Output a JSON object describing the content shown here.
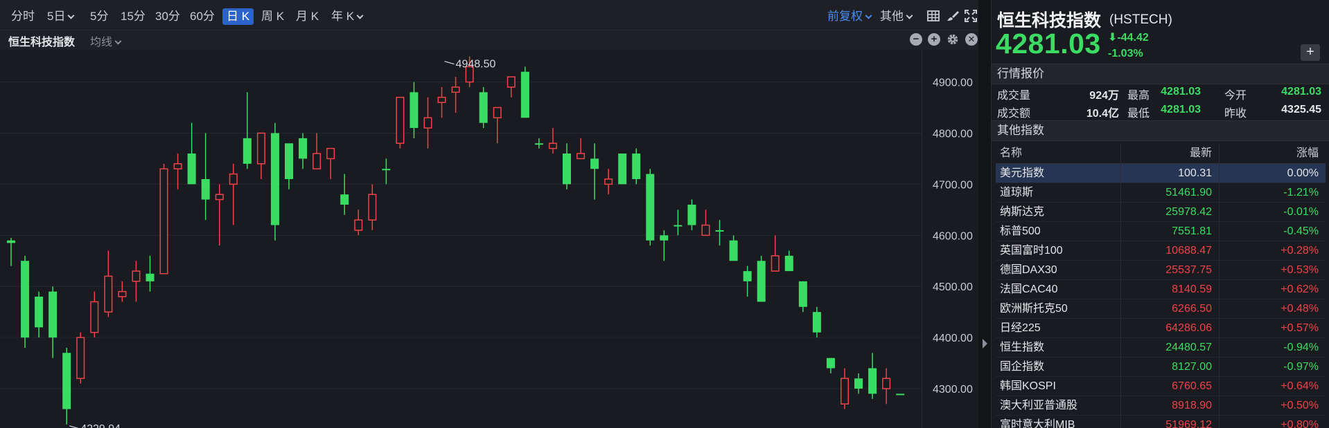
{
  "toolbar": {
    "periods": [
      {
        "label": "分时",
        "caret": false,
        "active": false
      },
      {
        "label": "5日",
        "caret": true,
        "active": false
      },
      {
        "label": "5分",
        "caret": false,
        "active": false
      },
      {
        "label": "15分",
        "caret": false,
        "active": false
      },
      {
        "label": "30分",
        "caret": false,
        "active": false
      },
      {
        "label": "60分",
        "caret": false,
        "active": false
      },
      {
        "label": "日 K",
        "caret": false,
        "active": true
      },
      {
        "label": "周 K",
        "caret": false,
        "active": false
      },
      {
        "label": "月 K",
        "caret": false,
        "active": false
      },
      {
        "label": "年 K",
        "caret": true,
        "active": false
      }
    ],
    "adjust_label": "前复权",
    "other_label": "其他",
    "icons": [
      "grid-icon",
      "brush-icon",
      "fullscreen-icon"
    ]
  },
  "chart": {
    "title": "恒生科技指数",
    "ma_label": "均线",
    "controls": [
      "minus-icon",
      "plus-icon",
      "gear-icon",
      "close-icon"
    ]
  },
  "chart_data": {
    "type": "candlestick",
    "y_ticks": [
      4900,
      4800,
      4700,
      4600,
      4500,
      4400,
      4300
    ],
    "y_tick_labels": [
      "4900.00",
      "4800.00",
      "4700.00",
      "4600.00",
      "4500.00",
      "4400.00",
      "4300.00"
    ],
    "ylim": [
      4223,
      4963
    ],
    "max_annotation": {
      "label": "4948.50",
      "index": 31,
      "value": 4948.5
    },
    "min_annotation": {
      "label": "4229.94",
      "index": 4,
      "value": 4229.94
    },
    "colors": {
      "up": "#f0424a",
      "down": "#3bdc64"
    },
    "candles": [
      [
        4590,
        4585,
        4595,
        4540
      ],
      [
        4550,
        4400,
        4560,
        4380
      ],
      [
        4480,
        4420,
        4490,
        4400
      ],
      [
        4490,
        4400,
        4500,
        4360
      ],
      [
        4370,
        4260,
        4380,
        4230
      ],
      [
        4320,
        4400,
        4410,
        4310
      ],
      [
        4410,
        4470,
        4490,
        4400
      ],
      [
        4450,
        4520,
        4570,
        4440
      ],
      [
        4480,
        4490,
        4510,
        4470
      ],
      [
        4510,
        4530,
        4550,
        4470
      ],
      [
        4525,
        4510,
        4560,
        4490
      ],
      [
        4525,
        4730,
        4740,
        4525
      ],
      [
        4730,
        4740,
        4760,
        4690
      ],
      [
        4760,
        4700,
        4820,
        4700
      ],
      [
        4710,
        4670,
        4800,
        4630
      ],
      [
        4670,
        4680,
        4700,
        4580
      ],
      [
        4700,
        4720,
        4740,
        4620
      ],
      [
        4790,
        4740,
        4880,
        4730
      ],
      [
        4740,
        4800,
        4790,
        4710
      ],
      [
        4800,
        4620,
        4820,
        4590
      ],
      [
        4780,
        4710,
        4740,
        4690
      ],
      [
        4790,
        4750,
        4800,
        4730
      ],
      [
        4730,
        4760,
        4800,
        4730
      ],
      [
        4750,
        4770,
        4770,
        4710
      ],
      [
        4680,
        4660,
        4720,
        4640
      ],
      [
        4610,
        4630,
        4650,
        4600
      ],
      [
        4630,
        4680,
        4700,
        4610
      ],
      [
        4730,
        4730,
        4750,
        4700
      ],
      [
        4780,
        4870,
        4870,
        4770
      ],
      [
        4880,
        4810,
        4900,
        4790
      ],
      [
        4810,
        4830,
        4870,
        4770
      ],
      [
        4860,
        4870,
        4890,
        4830
      ],
      [
        4880,
        4890,
        4910,
        4840
      ],
      [
        4900,
        4930,
        4950,
        4890
      ],
      [
        4880,
        4820,
        4890,
        4810
      ],
      [
        4830,
        4850,
        4850,
        4780
      ],
      [
        4890,
        4910,
        4900,
        4870
      ],
      [
        4920,
        4830,
        4930,
        4830
      ],
      [
        4780,
        4780,
        4790,
        4770
      ],
      [
        4770,
        4780,
        4810,
        4760
      ],
      [
        4760,
        4700,
        4780,
        4690
      ],
      [
        4750,
        4760,
        4790,
        4760
      ],
      [
        4750,
        4730,
        4780,
        4670
      ],
      [
        4700,
        4710,
        4730,
        4680
      ],
      [
        4760,
        4700,
        4760,
        4700
      ],
      [
        4760,
        4710,
        4770,
        4700
      ],
      [
        4720,
        4590,
        4730,
        4580
      ],
      [
        4600,
        4590,
        4610,
        4550
      ],
      [
        4620,
        4620,
        4650,
        4600
      ],
      [
        4660,
        4620,
        4670,
        4610
      ],
      [
        4600,
        4620,
        4650,
        4600
      ],
      [
        4610,
        4610,
        4630,
        4580
      ],
      [
        4590,
        4550,
        4600,
        4550
      ],
      [
        4530,
        4510,
        4540,
        4480
      ],
      [
        4550,
        4470,
        4560,
        4470
      ],
      [
        4530,
        4560,
        4600,
        4530
      ],
      [
        4560,
        4530,
        4570,
        4530
      ],
      [
        4510,
        4460,
        4510,
        4450
      ],
      [
        4450,
        4410,
        4460,
        4400
      ],
      [
        4360,
        4340,
        4360,
        4330
      ],
      [
        4270,
        4320,
        4340,
        4260
      ],
      [
        4320,
        4300,
        4330,
        4290
      ],
      [
        4340,
        4290,
        4370,
        4280
      ],
      [
        4300,
        4320,
        4340,
        4270
      ],
      [
        4290,
        4290,
        4290,
        4290
      ]
    ]
  },
  "quote": {
    "name": "恒生科技指数",
    "code": "(HSTECH)",
    "price": "4281.03",
    "change": "-44.42",
    "change_pct": "-1.03%",
    "add_label": "+",
    "section_quote": "行情报价",
    "stats": {
      "volume_label": "成交量",
      "volume": "924万",
      "high_label": "最高",
      "high": "4281.03",
      "open_label": "今开",
      "open": "4281.03",
      "turnover_label": "成交额",
      "turnover": "10.4亿",
      "low_label": "最低",
      "low": "4281.03",
      "prev_label": "昨收",
      "prev": "4325.45"
    },
    "section_other": "其他指数",
    "table_headers": {
      "name": "名称",
      "last": "最新",
      "chg": "涨幅"
    },
    "indices": [
      {
        "name": "美元指数",
        "last": "100.31",
        "chg": "0.00%",
        "dir": "flat",
        "selected": true
      },
      {
        "name": "道琼斯",
        "last": "51461.90",
        "chg": "-1.21%",
        "dir": "down",
        "selected": false
      },
      {
        "name": "纳斯达克",
        "last": "25978.42",
        "chg": "-0.01%",
        "dir": "down",
        "selected": false
      },
      {
        "name": "标普500",
        "last": "7551.81",
        "chg": "-0.45%",
        "dir": "down",
        "selected": false
      },
      {
        "name": "英国富时100",
        "last": "10688.47",
        "chg": "+0.28%",
        "dir": "up",
        "selected": false
      },
      {
        "name": "德国DAX30",
        "last": "25537.75",
        "chg": "+0.53%",
        "dir": "up",
        "selected": false
      },
      {
        "name": "法国CAC40",
        "last": "8140.59",
        "chg": "+0.62%",
        "dir": "up",
        "selected": false
      },
      {
        "name": "欧洲斯托克50",
        "last": "6266.50",
        "chg": "+0.48%",
        "dir": "up",
        "selected": false
      },
      {
        "name": "日经225",
        "last": "64286.06",
        "chg": "+0.57%",
        "dir": "up",
        "selected": false
      },
      {
        "name": "恒生指数",
        "last": "24480.57",
        "chg": "-0.94%",
        "dir": "down",
        "selected": false
      },
      {
        "name": "国企指数",
        "last": "8127.00",
        "chg": "-0.97%",
        "dir": "down",
        "selected": false
      },
      {
        "name": "韩国KOSPI",
        "last": "6760.65",
        "chg": "+0.64%",
        "dir": "up",
        "selected": false
      },
      {
        "name": "澳大利亚普通股",
        "last": "8918.90",
        "chg": "+0.50%",
        "dir": "up",
        "selected": false
      },
      {
        "name": "富时意大利MIB",
        "last": "51969.12",
        "chg": "+0.80%",
        "dir": "up",
        "selected": false
      }
    ]
  }
}
